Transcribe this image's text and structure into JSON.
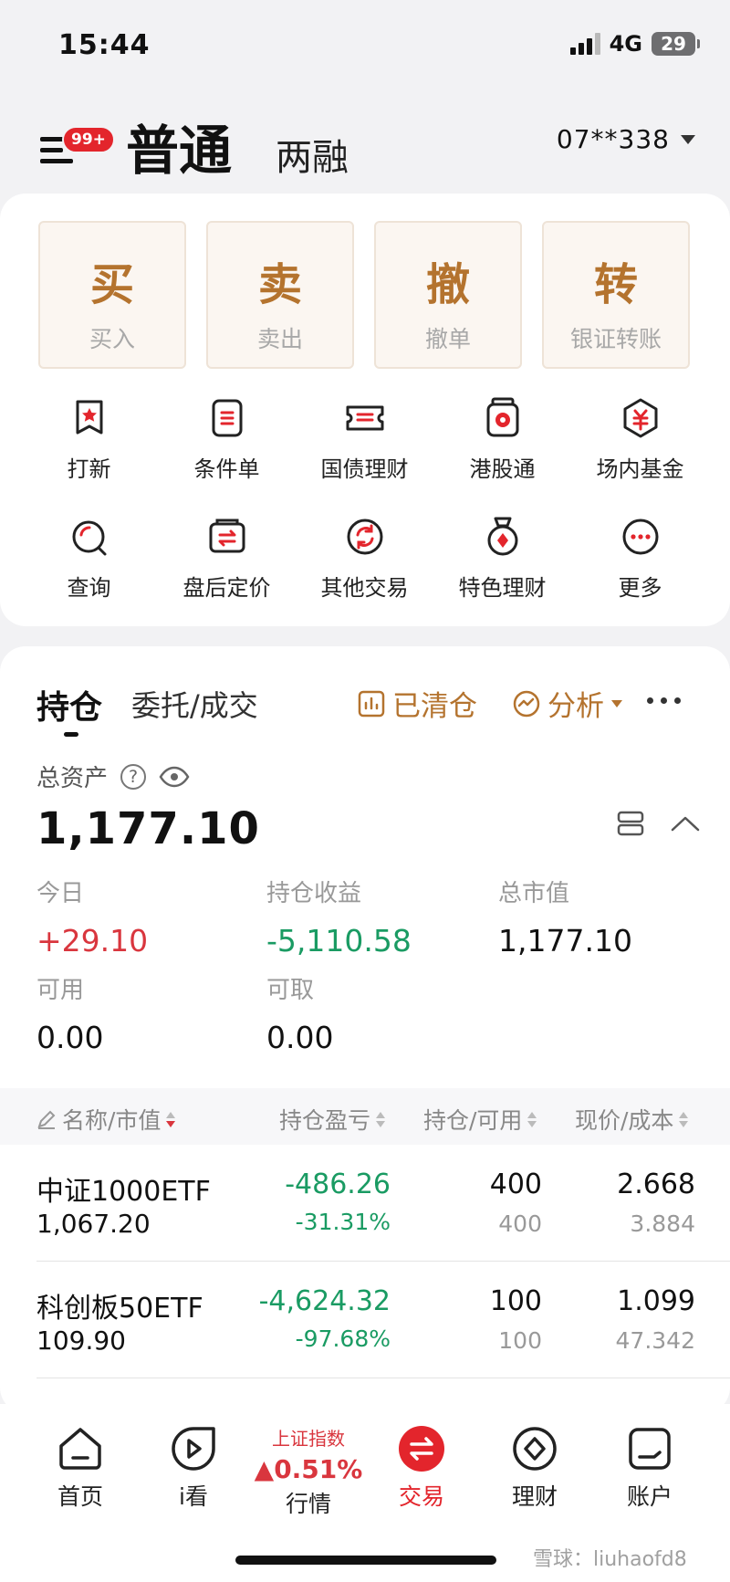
{
  "status_bar": {
    "time": "15:44",
    "network": "4G",
    "battery": "29"
  },
  "header": {
    "menu_badge": "99+",
    "tab_active": "普通",
    "tab_other": "两融",
    "account": "07**338"
  },
  "trade_buttons": [
    {
      "char": "买",
      "label": "买入"
    },
    {
      "char": "卖",
      "label": "卖出"
    },
    {
      "char": "撤",
      "label": "撤单"
    },
    {
      "char": "转",
      "label": "银证转账"
    }
  ],
  "features": [
    {
      "label": "打新",
      "icon": "ipo-icon"
    },
    {
      "label": "条件单",
      "icon": "condition-order-icon"
    },
    {
      "label": "国债理财",
      "icon": "bond-icon"
    },
    {
      "label": "港股通",
      "icon": "hk-connect-icon"
    },
    {
      "label": "场内基金",
      "icon": "fund-icon"
    },
    {
      "label": "查询",
      "icon": "query-icon"
    },
    {
      "label": "盘后定价",
      "icon": "after-hours-icon"
    },
    {
      "label": "其他交易",
      "icon": "other-trade-icon"
    },
    {
      "label": "特色理财",
      "icon": "featured-wealth-icon"
    },
    {
      "label": "更多",
      "icon": "more-icon"
    }
  ],
  "positions": {
    "tab_active": "持仓",
    "tab_other": "委托/成交",
    "cleared_label": "已清仓",
    "analysis_label": "分析",
    "total_assets_label": "总资产",
    "total_assets": "1,177.10",
    "stats": {
      "today_label": "今日",
      "today": "+29.10",
      "pnl_label": "持仓收益",
      "pnl": "-5,110.58",
      "market_value_label": "总市值",
      "market_value": "1,177.10",
      "available_label": "可用",
      "available": "0.00",
      "withdrawable_label": "可取",
      "withdrawable": "0.00"
    },
    "columns": [
      "名称/市值",
      "持仓盈亏",
      "持仓/可用",
      "现价/成本"
    ],
    "rows": [
      {
        "name": "中证1000ETF",
        "value": "1,067.20",
        "pnl": "-486.26",
        "pnl_pct": "-31.31%",
        "hold": "400",
        "avail": "400",
        "price": "2.668",
        "cost": "3.884"
      },
      {
        "name": "科创板50ETF",
        "value": "109.90",
        "pnl": "-4,624.32",
        "pnl_pct": "-97.68%",
        "hold": "100",
        "avail": "100",
        "price": "1.099",
        "cost": "47.342"
      }
    ]
  },
  "bottom_nav": {
    "home": "首页",
    "watch": "i看",
    "index_name": "上证指数",
    "index_change": "▲0.51%",
    "market": "行情",
    "trade": "交易",
    "wealth": "理财",
    "account": "账户"
  },
  "watermark": "雪球：liuhaofd8",
  "colors": {
    "accent_gold": "#b4732e",
    "red": "#d9363e",
    "green": "#1a9b63",
    "brand_red": "#e3252c"
  }
}
